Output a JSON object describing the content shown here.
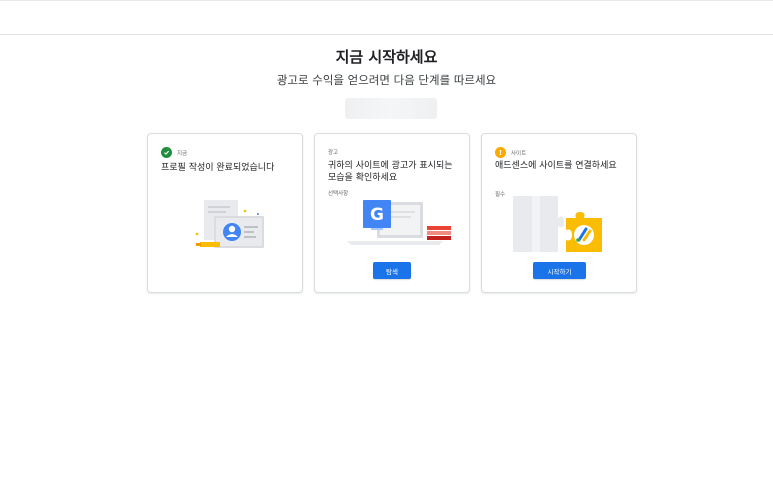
{
  "header": {
    "title": "지금 시작하세요",
    "subtitle": "광고로 수익을 얻으려면 다음 단계를 따르세요"
  },
  "cards": [
    {
      "eyebrow": "지금",
      "status_icon": "check-circle-icon",
      "title": "프로필 작성이 완료되었습니다"
    },
    {
      "eyebrow": "광고",
      "title": "귀하의 사이트에 광고가 표시되는 모습을 확인하세요",
      "tag": "선택사항",
      "button_label": "탐색"
    },
    {
      "eyebrow": "사이트",
      "status_icon": "alert-circle-icon",
      "status_symbol": "!",
      "title": "애드센스에 사이트를 연결하세요",
      "tag": "필수",
      "button_label": "시작하기"
    }
  ],
  "colors": {
    "primary": "#1a73e8",
    "success": "#1e8e3e",
    "warning": "#f9ab00"
  }
}
